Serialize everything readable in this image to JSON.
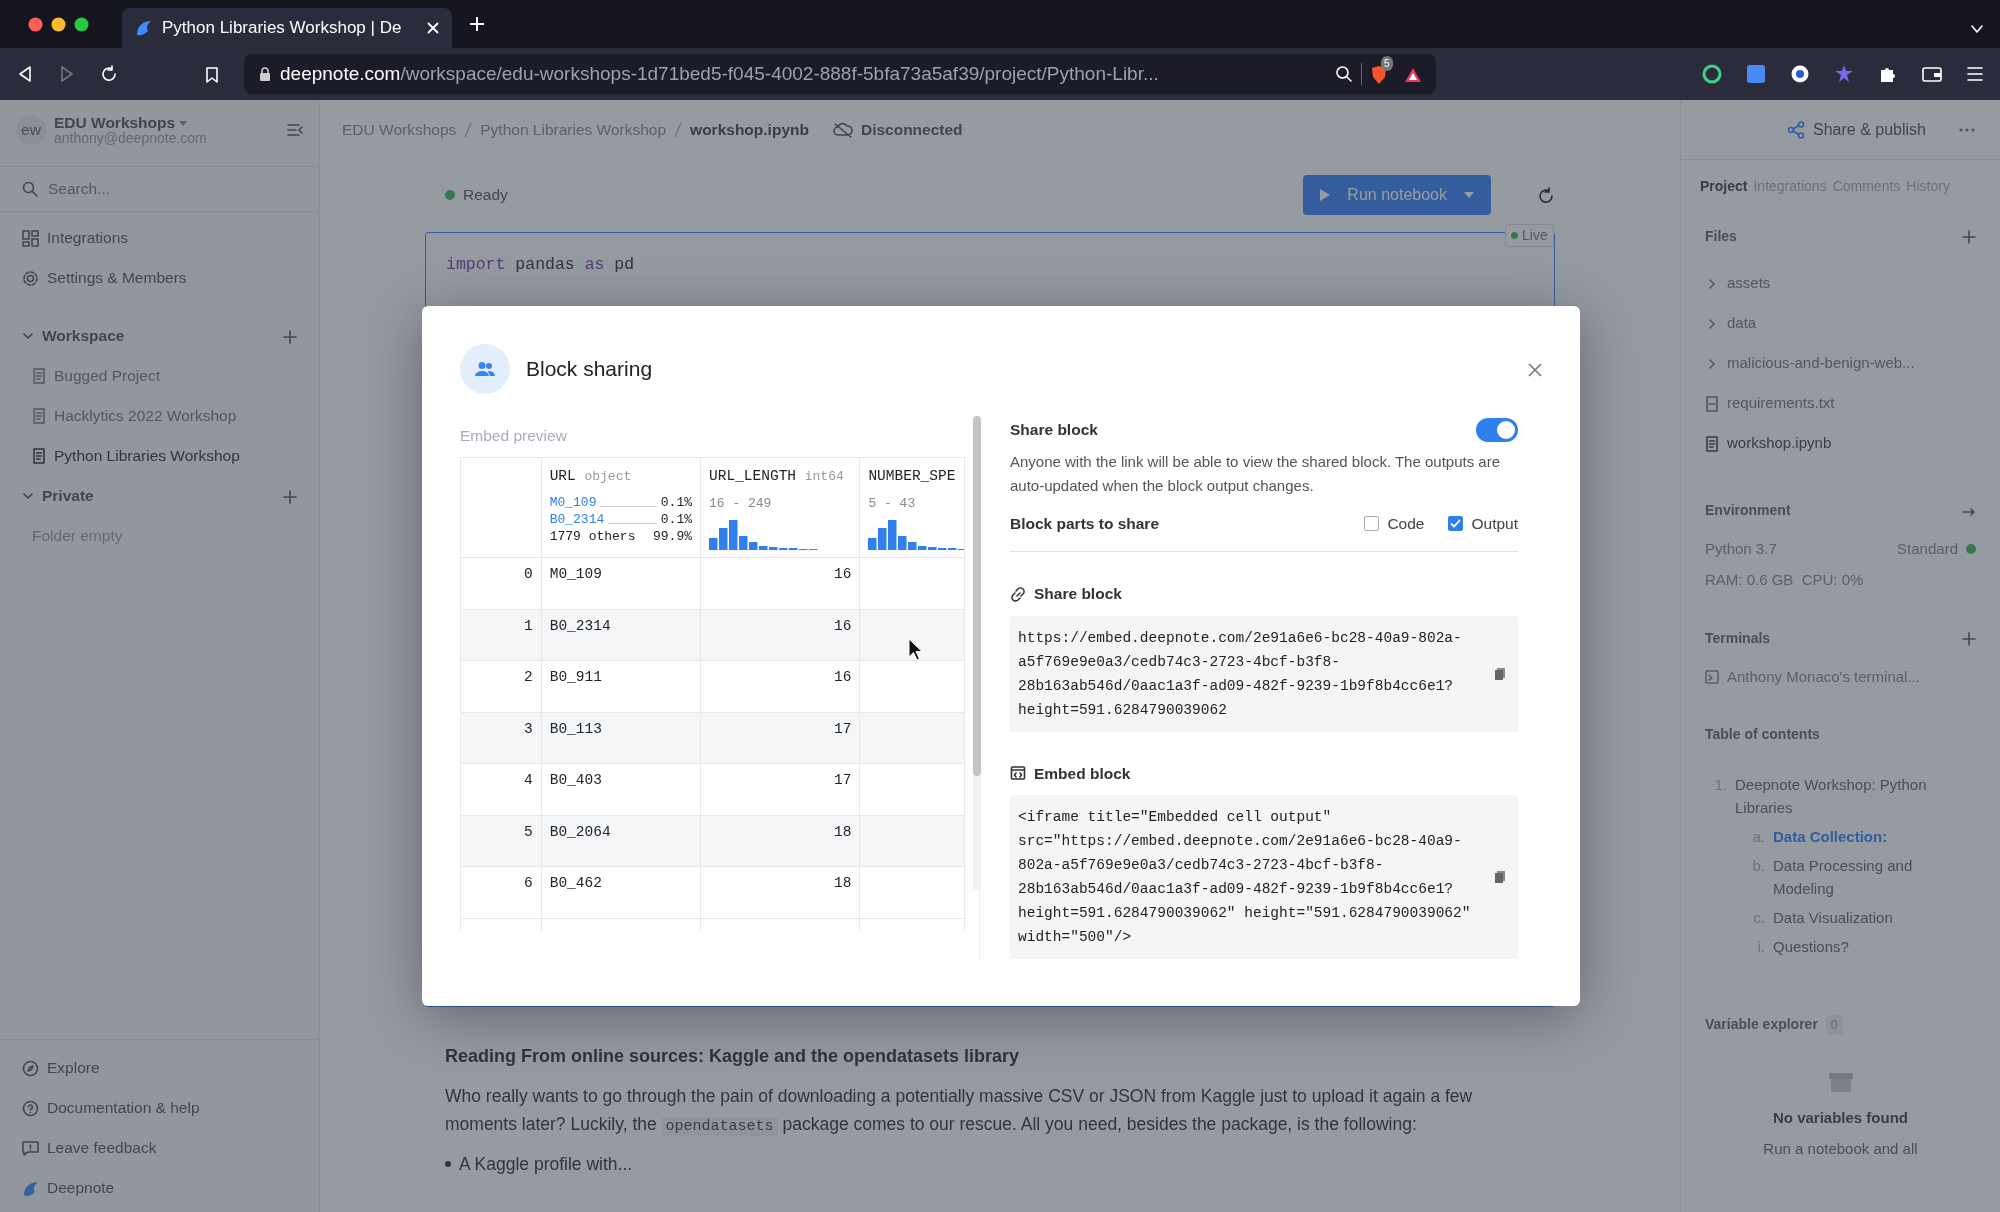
{
  "browser": {
    "tabs": [
      {
        "title": "Python Libraries Workshop | De",
        "selected": true
      }
    ],
    "url": {
      "host": "deepnote.com",
      "path": "/workspace/edu-workshops-1d71bed5-f045-4002-888f-5bfa73a5af39/project/Python-Libr..."
    },
    "shield_count": "5"
  },
  "sidebar": {
    "workspace": {
      "avatar": "ew",
      "name": "EDU Workshops",
      "email": "anthony@deepnote.com"
    },
    "search": {
      "placeholder": "Search..."
    },
    "nav": [
      {
        "kind": "grid",
        "label": "Integrations"
      },
      {
        "kind": "gear",
        "label": "Settings & Members"
      }
    ],
    "sections": [
      {
        "title": "Workspace",
        "expanded": true,
        "items": [
          {
            "label": "Bugged Project",
            "selected": false
          },
          {
            "label": "Hacklytics 2022 Workshop",
            "selected": false
          },
          {
            "label": "Python Libraries Workshop",
            "selected": true
          }
        ]
      },
      {
        "title": "Private",
        "expanded": true,
        "empty_text": "Folder empty"
      }
    ],
    "footer": [
      {
        "kind": "compass",
        "label": "Explore"
      },
      {
        "kind": "help",
        "label": "Documentation & help"
      },
      {
        "kind": "feedback",
        "label": "Leave feedback"
      },
      {
        "kind": "logo",
        "label": "Deepnote"
      }
    ]
  },
  "header": {
    "breadcrumbs": [
      "EDU Workshops",
      "Python Libraries Workshop",
      "workshop.ipynb"
    ],
    "connection": "Disconnected",
    "share": "Share & publish"
  },
  "notebook": {
    "status": "Ready",
    "run_button": "Run notebook",
    "live_badge": "Live",
    "code_lines": [
      [
        {
          "kind": "keyword",
          "text": "import"
        },
        {
          "kind": "name",
          "text": " pandas "
        },
        {
          "kind": "keyword",
          "text": "as"
        },
        {
          "kind": "name",
          "text": " pd"
        }
      ]
    ],
    "heading": "Reading From online sources: Kaggle and the opendatasets library",
    "paragraph": [
      {
        "kind": "text",
        "s": "Who really wants to go through the pain of downloading a potentially massive CSV or JSON from Kaggle just to upload it again a few moments later? Luckily, the "
      },
      {
        "kind": "code",
        "s": "opendatasets"
      },
      {
        "kind": "text",
        "s": " package comes to our rescue. All you need, besides the package, is the following:"
      }
    ],
    "bullets": [
      "A Kaggle profile with..."
    ]
  },
  "right_panel": {
    "tabs": [
      {
        "label": "Project",
        "selected": true
      },
      {
        "label": "Integrations",
        "selected": false
      },
      {
        "label": "Comments",
        "selected": false
      },
      {
        "label": "History",
        "selected": false
      }
    ],
    "files_title": "Files",
    "files": [
      {
        "kind": "folder",
        "name": "assets"
      },
      {
        "kind": "folder",
        "name": "data"
      },
      {
        "kind": "folder",
        "name": "malicious-and-benign-web..."
      },
      {
        "kind": "txt",
        "name": "requirements.txt"
      },
      {
        "kind": "notebook",
        "name": "workshop.ipynb"
      }
    ],
    "environment": {
      "title": "Environment",
      "python": "Python 3.7",
      "machine": "Standard",
      "running": true,
      "stats": "RAM: 0.6 GB  CPU: 0%"
    },
    "terminals": {
      "title": "Terminals",
      "items": [
        "Anthony Monaco's terminal..."
      ]
    },
    "toc": {
      "title": "Table of contents",
      "items": [
        {
          "marker": "1.",
          "label": "Deepnote Workshop: Python Libraries",
          "selected": false,
          "children": [
            {
              "marker": "a.",
              "label": "Data Collection:",
              "selected": true
            },
            {
              "marker": "b.",
              "label": "Data Processing and Modeling",
              "selected": false
            },
            {
              "marker": "c.",
              "label": "Data Visualization",
              "selected": false,
              "children": [
                {
                  "marker": "i.",
                  "label": "Questions?",
                  "selected": false
                }
              ]
            }
          ]
        }
      ]
    },
    "variables": {
      "title": "Variable explorer",
      "count": "0",
      "empty_title": "No variables found",
      "empty_text": "Run a notebook and all"
    }
  },
  "modal": {
    "title": "Block sharing",
    "preview_label": "Embed preview",
    "table": {
      "columns": [
        {
          "name": "URL",
          "dtype": "object",
          "kind": "categories",
          "top": [
            {
              "label": "M0_109",
              "share": "0.1%"
            },
            {
              "label": "B0_2314",
              "share": "0.1%"
            }
          ],
          "others": "1779 others",
          "others_share": "99.9%"
        },
        {
          "name": "URL_LENGTH",
          "dtype": "int64",
          "kind": "histogram",
          "range": "16 - 249"
        },
        {
          "name": "NUMBER_SPE",
          "kind": "histogram",
          "range": "5 - 43"
        }
      ],
      "rows": [
        {
          "index": "0",
          "cells": [
            "M0_109",
            "16",
            ""
          ]
        },
        {
          "index": "1",
          "cells": [
            "B0_2314",
            "16",
            ""
          ]
        },
        {
          "index": "2",
          "cells": [
            "B0_911",
            "16",
            ""
          ]
        },
        {
          "index": "3",
          "cells": [
            "B0_113",
            "17",
            ""
          ]
        },
        {
          "index": "4",
          "cells": [
            "B0_403",
            "17",
            ""
          ]
        },
        {
          "index": "5",
          "cells": [
            "B0_2064",
            "18",
            ""
          ]
        },
        {
          "index": "6",
          "cells": [
            "B0_462",
            "18",
            ""
          ]
        }
      ]
    },
    "share_toggle": {
      "label": "Share block",
      "on": true
    },
    "description": "Anyone with the link will be able to view the shared block. The outputs are auto-updated when the block output changes.",
    "parts_label": "Block parts to share",
    "parts": [
      {
        "label": "Code",
        "checked": false
      },
      {
        "label": "Output",
        "checked": true
      }
    ],
    "snippets": [
      {
        "kind": "link",
        "title": "Share block",
        "lines": [
          "https://embed.deepnote.com/2e91a6e6-bc28-40a9-802a-",
          "a5f769e9e0a3/cedb74c3-2723-4bcf-b3f8-",
          "28b163ab546d/0aac1a3f-ad09-482f-9239-1b9f8b4cc6e1?",
          "height=591.6284790039062"
        ]
      },
      {
        "kind": "embed",
        "title": "Embed block",
        "lines": [
          "<iframe title=\"Embedded cell output\"",
          "src=\"https://embed.deepnote.com/2e91a6e6-bc28-40a9-",
          "802a-a5f769e9e0a3/cedb74c3-2723-4bcf-b3f8-",
          "28b163ab546d/0aac1a3f-ad09-482f-9239-1b9f8b4cc6e1?",
          "height=591.6284790039062\" height=\"591.6284790039062\"",
          "width=\"500\"/>"
        ]
      }
    ]
  }
}
